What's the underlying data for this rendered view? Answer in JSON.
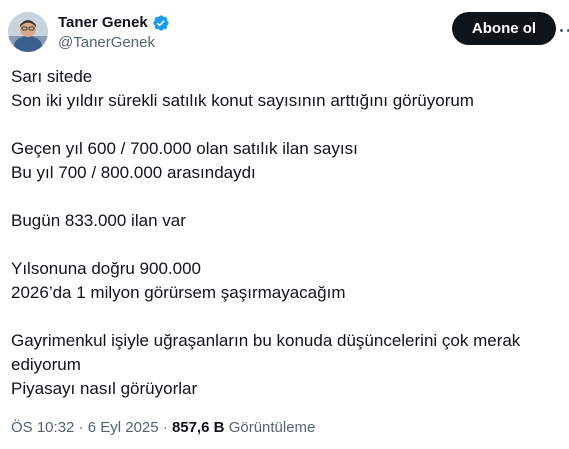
{
  "author": {
    "display_name": "Taner Genek",
    "handle": "@TanerGenek",
    "verified": true,
    "verified_icon": "verified-badge-icon"
  },
  "actions": {
    "follow_label": "Abone ol",
    "more_icon": "more-options-icon"
  },
  "tweet": {
    "lines": [
      "Sarı sitede",
      "Son iki yıldır sürekli satılık konut sayısının arttığını görüyorum",
      "",
      "Geçen yıl 600 / 700.000 olan satılık ilan sayısı",
      "Bu yıl 700 / 800.000 arasındaydı",
      "",
      "Bugün 833.000 ilan var",
      "",
      "Yılsonuna doğru 900.000",
      "2026’da 1 milyon görürsem şaşırmayacağım",
      "",
      "Gayrimenkul işiyle uğraşanların bu konuda düşüncelerini çok merak",
      "ediyorum",
      "Piyasayı nasıl görüyorlar"
    ]
  },
  "meta": {
    "time": "ÖS 10:32",
    "separator": "·",
    "date": "6 Eyl 2025",
    "views_count": "857,6 B",
    "views_label": "Görüntüleme"
  },
  "colors": {
    "text_primary": "#0f1419",
    "text_secondary": "#536471",
    "verified_blue": "#1d9bf0",
    "button_bg": "#0f1419"
  }
}
